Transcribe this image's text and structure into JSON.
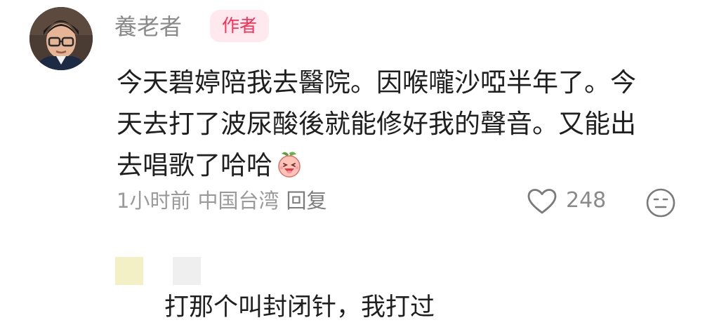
{
  "comment": {
    "username": "養老者",
    "badge": "作者",
    "lines": [
      "今天碧婷陪我去醫院。因喉嚨沙啞半年了。今",
      "天去打了波尿酸後就能修好我的聲音。又能出",
      "去唱歌了哈哈"
    ],
    "emoji": "laughing-peach-emoji",
    "time": "1小时前",
    "location": "中国台湾",
    "reply_label": "回复",
    "like_count": "248",
    "icons": {
      "like": "heart-outline-icon",
      "react": "neutral-face-icon"
    }
  },
  "reply": {
    "text": "打那个叫封闭针，我打过"
  },
  "colors": {
    "badge_text": "#ff2d55",
    "badge_bg": "#ffe9ee",
    "muted_text": "#9a9a9a",
    "body_text": "#1f1f1f"
  }
}
